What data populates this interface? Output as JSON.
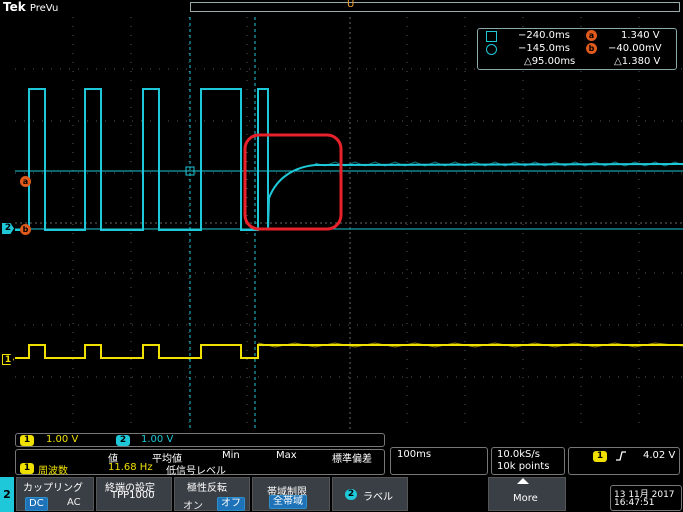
{
  "brand": {
    "maker": "Tek",
    "mode": "PreVu"
  },
  "trigger_marker": "U",
  "cursors": {
    "row1": {
      "icon": "square-cursor-icon",
      "time": "−240.0ms",
      "badge": "a",
      "value": "1.340 V"
    },
    "row2": {
      "icon": "circle-cursor-icon",
      "time": "−145.0ms",
      "badge": "b",
      "value": "−40.00mV"
    },
    "row3": {
      "delta_time": "△95.00ms",
      "delta_value": "△1.380 V"
    }
  },
  "markers": {
    "a": "a",
    "b": "b"
  },
  "channels": {
    "ch1": {
      "badge": "1",
      "color": "#f0e000",
      "scale": "1.00 V"
    },
    "ch2": {
      "badge": "2",
      "color": "#1ec8d8",
      "scale": "1.00 V"
    }
  },
  "measurement": {
    "badge": "1",
    "label": "周波数",
    "headers": [
      "値",
      "平均値",
      "Min",
      "Max",
      "標準偏差"
    ],
    "value": "11.68 Hz",
    "note": "低信号レベル"
  },
  "timebase": {
    "scale": "100ms"
  },
  "acquisition": {
    "rate": "10.0kS/s",
    "points": "10k points"
  },
  "trigger": {
    "channel": "1",
    "slope_icon": "rising-edge-icon",
    "level": "4.02 V"
  },
  "menu": {
    "channel_tab": "2",
    "coupling": {
      "label": "カップリング",
      "options": [
        "DC",
        "AC"
      ],
      "selected": "DC"
    },
    "termination": {
      "label": "終端の設定",
      "value": "TPP1000"
    },
    "invert": {
      "label": "極性反転",
      "options": [
        "オン",
        "オフ"
      ],
      "selected": "オフ"
    },
    "bandwidth": {
      "label": "帯域制限",
      "value": "全帯域"
    },
    "label_btn": {
      "badge": "2",
      "label": "ラベル"
    },
    "more": "More"
  },
  "datetime": {
    "date": "13 11月 2017",
    "time": "16:47:51"
  },
  "colors": {
    "ch1": "#f0e000",
    "ch2": "#1ec8d8",
    "cursor_badge": "#e05a1c",
    "highlight": "#e8222a",
    "grid": "#555555"
  }
}
